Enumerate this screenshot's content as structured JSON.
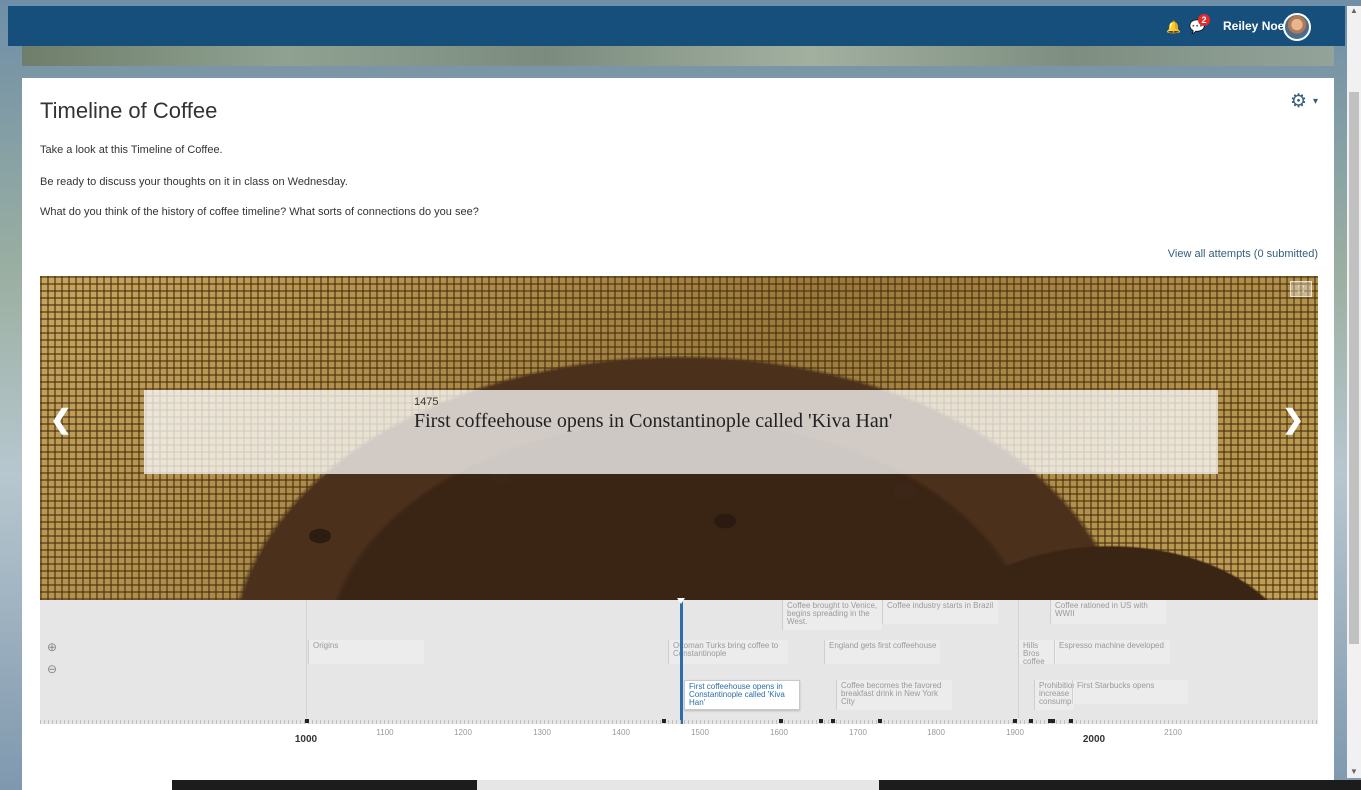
{
  "header": {
    "notifications_count": "2",
    "user_name": "Reiley Noe",
    "bell_icon": "bell-icon",
    "chat_icon": "chat-icon"
  },
  "page": {
    "title": "Timeline of Coffee",
    "paragraphs": [
      "Take a look at this Timeline of Coffee.",
      "Be ready to discuss your thoughts on it in class on Wednesday.",
      "What do you think of the history of coffee timeline? What sorts of connections do you see?"
    ],
    "view_attempts": "View all attempts (0 submitted)",
    "settings_icon": "gear-icon"
  },
  "timeline": {
    "current_event": {
      "year": "1475",
      "headline": "First coffeehouse opens in Constantinople called 'Kiva Han'"
    },
    "prev_nav_icon": "chevron-left-icon",
    "next_nav_icon": "chevron-right-icon",
    "fullscreen_icon": "fullscreen-icon",
    "zoom_in_icon": "zoom-in-icon",
    "zoom_out_icon": "zoom-out-icon",
    "markers": [
      {
        "text": "Origins"
      },
      {
        "text": "Ottoman Turks bring coffee to Constantinople"
      },
      {
        "text": "First coffeehouse opens in Constantinople called 'Kiva Han'"
      },
      {
        "text": "Coffee brought to Venice, begins spreading in the West."
      },
      {
        "text": "Coffee industry starts in Brazil"
      },
      {
        "text": "England gets first coffeehouse"
      },
      {
        "text": "Coffee becomes the favored breakfast drink in New York City"
      },
      {
        "text": "Hills Bros coffee in"
      },
      {
        "text": "Prohibition increase consump"
      },
      {
        "text": "Coffee rationed in US with WWII"
      },
      {
        "text": "Espresso machine developed"
      },
      {
        "text": "First Starbucks opens"
      }
    ],
    "ticks": [
      {
        "label": "1000",
        "major": true
      },
      {
        "label": "1100",
        "major": false
      },
      {
        "label": "1200",
        "major": false
      },
      {
        "label": "1300",
        "major": false
      },
      {
        "label": "1400",
        "major": false
      },
      {
        "label": "1500",
        "major": false
      },
      {
        "label": "1600",
        "major": false
      },
      {
        "label": "1700",
        "major": false
      },
      {
        "label": "1800",
        "major": false
      },
      {
        "label": "1900",
        "major": false
      },
      {
        "label": "2000",
        "major": true
      },
      {
        "label": "2100",
        "major": false
      }
    ]
  },
  "colors": {
    "header_bg": "#164f7b",
    "accent": "#2a6fa8",
    "notification_badge": "#e42b2b"
  }
}
